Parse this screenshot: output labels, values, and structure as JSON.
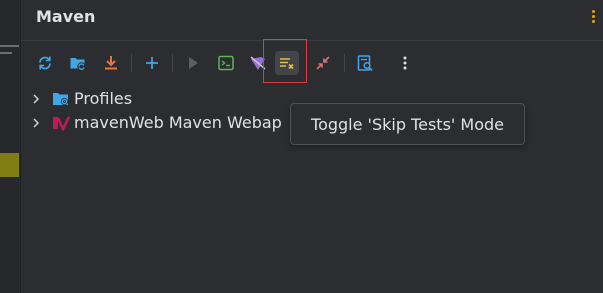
{
  "panel": {
    "title": "Maven"
  },
  "toolbar": {
    "buttons": [
      {
        "icon": "reload-all-projects-icon",
        "color": "#3fa7e8"
      },
      {
        "icon": "generate-sources-icon",
        "color": "#3fa7e8"
      },
      {
        "icon": "download-sources-icon",
        "color": "#e8734a"
      },
      {
        "icon": "add-maven-project-icon",
        "color": "#3fa7e8"
      },
      {
        "icon": "run-maven-build-icon",
        "color": "#5b5e63"
      },
      {
        "icon": "execute-maven-goal-icon",
        "color": "#5fb35a"
      },
      {
        "icon": "toggle-offline-mode-icon",
        "color": "#9b6fd6"
      },
      {
        "icon": "toggle-skip-tests-icon",
        "color": "#e5c030"
      },
      {
        "icon": "collapse-all-icon",
        "color": "#d8737a"
      },
      {
        "icon": "analyze-dependencies-icon",
        "color": "#3fa7e8"
      },
      {
        "icon": "more-options-icon",
        "color": "#dfe1e5"
      }
    ]
  },
  "tree": {
    "items": [
      {
        "label": "Profiles",
        "icon": "profiles-folder-icon"
      },
      {
        "label": "mavenWeb Maven Webap",
        "icon": "maven-module-icon"
      }
    ]
  },
  "tooltip": {
    "text": "Toggle 'Skip Tests' Mode"
  },
  "colors": {
    "panel_bg": "#2b2d30",
    "text": "#dfe1e5",
    "focus_ring": "#e0393e",
    "editor_highlight": "#7f7d14"
  }
}
